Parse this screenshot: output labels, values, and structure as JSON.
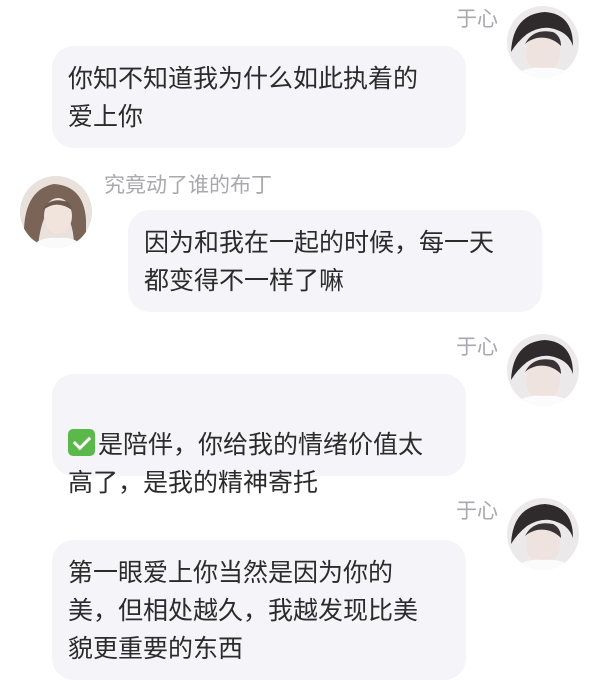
{
  "messages": [
    {
      "sender": "于心",
      "side": "right",
      "text": "你知不知道我为什么如此执着的\n爱上你"
    },
    {
      "sender": "究竟动了谁的布丁",
      "side": "left",
      "text": "因为和我在一起的时候，每一天\n都变得不一样了嘛"
    },
    {
      "sender": "于心",
      "side": "right",
      "emoji": "check-mark-button",
      "text": "是陪伴，你给我的情绪价值太\n高了，是我的精神寄托"
    },
    {
      "sender": "于心",
      "side": "right",
      "text": "第一眼爱上你当然是因为你的\n美，但相处越久，我越发现比美\n貌更重要的东西"
    }
  ],
  "colors": {
    "bubble": "#f4f4f9",
    "name": "#a8a8ae",
    "text": "#2b2b2b",
    "check": "#5bb84a"
  }
}
